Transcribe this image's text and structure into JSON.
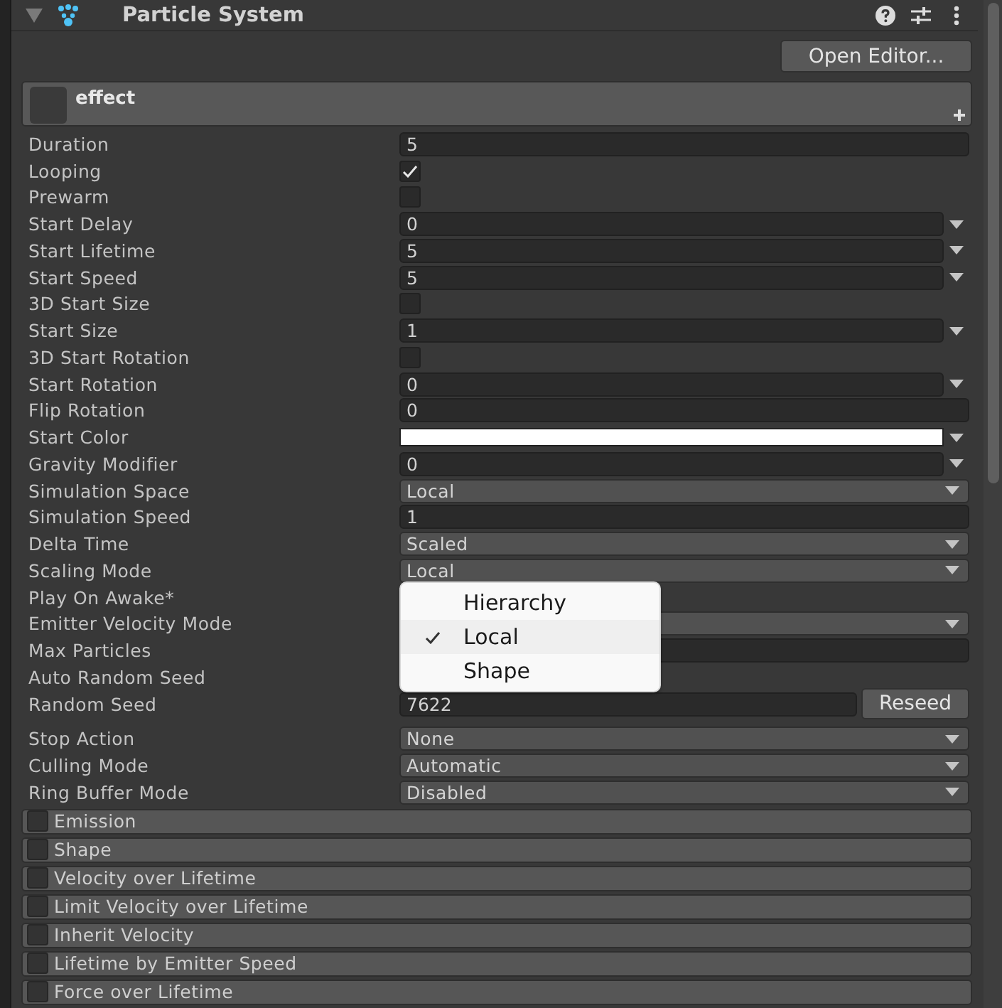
{
  "component": {
    "title": "Particle System",
    "expanded": true,
    "open_editor_button": "Open Editor...",
    "system_name": "effect"
  },
  "properties": [
    {
      "label": "Duration",
      "kind": "number",
      "value": "5"
    },
    {
      "label": "Looping",
      "kind": "checkbox",
      "checked": true
    },
    {
      "label": "Prewarm",
      "kind": "checkbox",
      "checked": false
    },
    {
      "label": "Start Delay",
      "kind": "curve",
      "value": "0"
    },
    {
      "label": "Start Lifetime",
      "kind": "curve",
      "value": "5"
    },
    {
      "label": "Start Speed",
      "kind": "curve",
      "value": "5"
    },
    {
      "label": "3D Start Size",
      "kind": "checkbox",
      "checked": false
    },
    {
      "label": "Start Size",
      "kind": "curve",
      "value": "1"
    },
    {
      "label": "3D Start Rotation",
      "kind": "checkbox",
      "checked": false
    },
    {
      "label": "Start Rotation",
      "kind": "curve",
      "value": "0"
    },
    {
      "label": "Flip Rotation",
      "kind": "number",
      "value": "0"
    },
    {
      "label": "Start Color",
      "kind": "color",
      "color": "#ffffff"
    },
    {
      "label": "Gravity Modifier",
      "kind": "curve",
      "value": "0"
    },
    {
      "label": "Simulation Space",
      "kind": "enum",
      "value": "Local"
    },
    {
      "label": "Simulation Speed",
      "kind": "number",
      "value": "1"
    },
    {
      "label": "Delta Time",
      "kind": "enum",
      "value": "Scaled"
    },
    {
      "label": "Scaling Mode",
      "kind": "enum",
      "value": "Local"
    },
    {
      "label": "Play On Awake*",
      "kind": "covered"
    },
    {
      "label": "Emitter Velocity Mode",
      "kind": "enum"
    },
    {
      "label": "Max Particles",
      "kind": "number"
    },
    {
      "label": "Auto Random Seed",
      "kind": "covered"
    },
    {
      "label": "Random Seed",
      "kind": "seed",
      "value": "7622",
      "button": "Reseed"
    },
    {
      "label": "Stop Action",
      "kind": "enum",
      "value": "None",
      "spaced": true
    },
    {
      "label": "Culling Mode",
      "kind": "enum",
      "value": "Automatic"
    },
    {
      "label": "Ring Buffer Mode",
      "kind": "enum",
      "value": "Disabled"
    }
  ],
  "dropdown_menu": [
    {
      "label": "Hierarchy",
      "selected": false
    },
    {
      "label": "Local",
      "selected": true
    },
    {
      "label": "Shape",
      "selected": false
    }
  ],
  "modules": [
    {
      "label": "Emission",
      "enabled": false
    },
    {
      "label": "Shape",
      "enabled": false
    },
    {
      "label": "Velocity over Lifetime",
      "enabled": false
    },
    {
      "label": "Limit Velocity over Lifetime",
      "enabled": false
    },
    {
      "label": "Inherit Velocity",
      "enabled": false
    },
    {
      "label": "Lifetime by Emitter Speed",
      "enabled": false
    },
    {
      "label": "Force over Lifetime",
      "enabled": false
    }
  ]
}
